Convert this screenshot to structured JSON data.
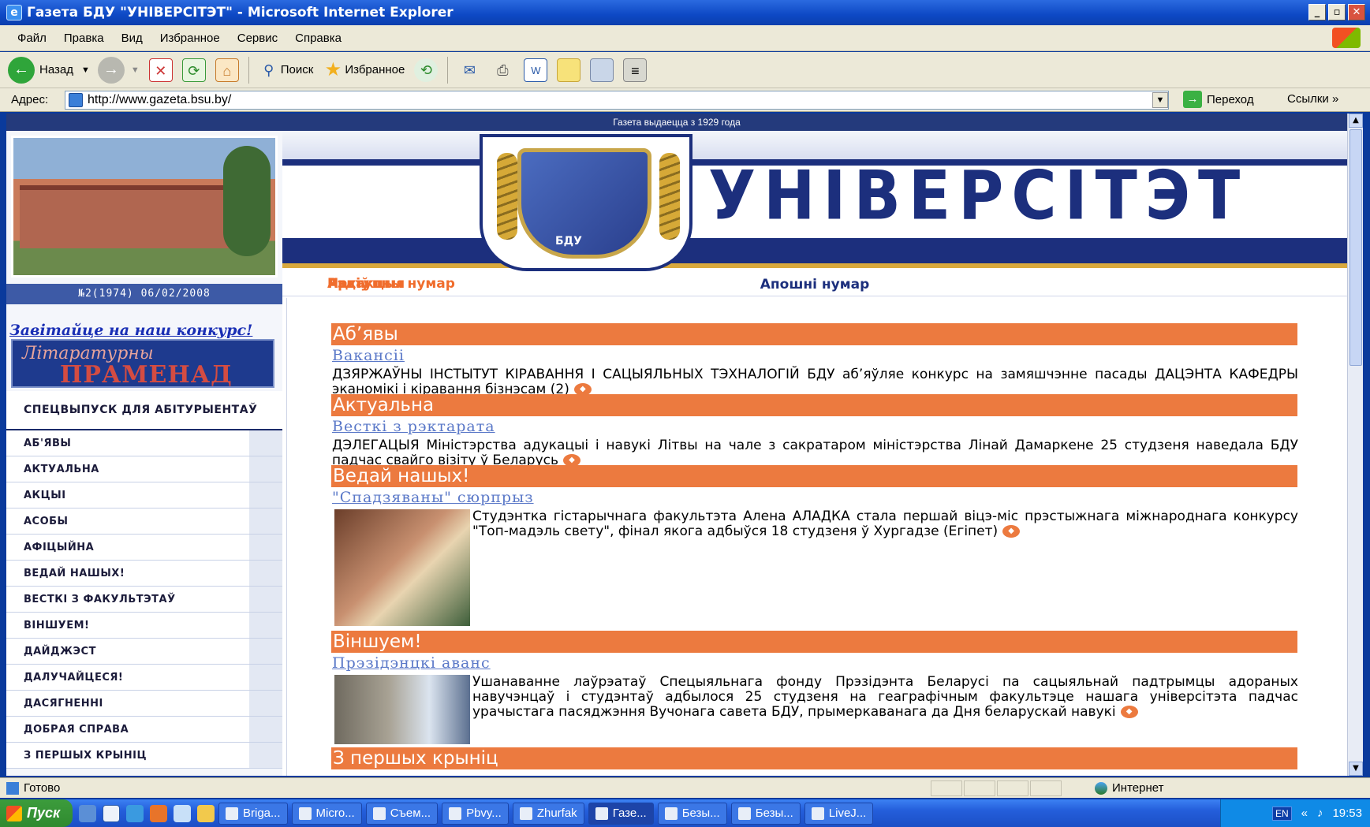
{
  "window": {
    "title": "Газета БДУ \"УНІВЕРСІТЭТ\" - Microsoft Internet Explorer"
  },
  "menu": [
    "Файл",
    "Правка",
    "Вид",
    "Избранное",
    "Сервис",
    "Справка"
  ],
  "toolbar": {
    "back": "Назад",
    "search": "Поиск",
    "favorites": "Избранное"
  },
  "address": {
    "label": "Адрес:",
    "url": "http://www.gazeta.bsu.by/",
    "go": "Переход",
    "links": "Ссылки"
  },
  "site": {
    "since": "Газета выдаецца з 1929 года",
    "brand": "УНІВЕРСІТЭТ",
    "crest_text": "БДУ",
    "issue": "№2(1974) 06/02/2008",
    "konkurs": "Завітайце на наш конкурс!",
    "banner_line1": "Літаратурны",
    "banner_line2": "ПРАМЕНАД",
    "tabs": [
      "Апошні нумар",
      "Наступны нумар",
      "Архіў",
      "Рэдакцыя"
    ],
    "nav": [
      "СПЕЦВЫПУСК ДЛЯ АБІТУРЫЕНТАЎ",
      "АБ'ЯВЫ",
      "АКТУАЛЬНА",
      "АКЦЫІ",
      "АСОБЫ",
      "АФІЦЫЙНА",
      "ВЕДАЙ НАШЫХ!",
      "ВЕСТКІ З ФАКУЛЬТЭТАЎ",
      "ВІНШУЕМ!",
      "ДАЙДЖЭСТ",
      "ДАЛУЧАЙЦЕСЯ!",
      "ДАСЯГНЕННІ",
      "ДОБРАЯ СПРАВА",
      "З ПЕРШЫХ КРЫНІЦ"
    ]
  },
  "sections": [
    {
      "title": "Аб’явы",
      "headline": "Вакансіі",
      "text": "ДЗЯРЖАЎНЫ ІНСТЫТУТ КІРАВАННЯ І САЦЫЯЛЬНЫХ ТЭХНАЛОГІЙ БДУ аб’яўляе конкурс на замяшчэнне пасады ДАЦЭНТА КАФЕДРЫ эканомікі і кіравання бізнэсам (2)"
    },
    {
      "title": "Актуальна",
      "headline": "Весткі з рэктарата",
      "text": "ДЭЛЕГАЦЫЯ Міністэрства адукацыі і навукі Літвы на чале з сакратаром міністэрства Лінай Дамаркене 25 студзеня наведала БДУ падчас свайго візіту ў Беларусь"
    },
    {
      "title": "Ведай нашых!",
      "headline": "\"Спадзяваны\" сюрпрыз",
      "text": "Студэнтка гістарычнага факультэта Алена АЛАДКА стала першай віцэ-міс прэстыжнага міжнароднага конкурсу \"Топ-мадэль свету\", фінал якога адбыўся 18 студзеня ў Хургадзе (Егіпет)"
    },
    {
      "title": "Віншуем!",
      "headline": "Прэзідэнцкі аванс",
      "text": "Ушанаванне лаўрэатаў Спецыяльнага фонду Прэзідэнта Беларусі па сацыяльнай падтрымцы адораных навучэнцаў і студэнтаў адбылося 25 студзеня на геаграфічным факультэце нашага універсітэта падчас урачыстага пасяджэння Вучонага савета БДУ, прымеркаванага да Дня беларускай навукі"
    },
    {
      "title": "З першых крыніц"
    }
  ],
  "status": {
    "left": "Готово",
    "zone": "Интернет"
  },
  "taskbar": {
    "start": "Пуск",
    "tasks": [
      "Briga...",
      "Micro...",
      "Съем...",
      "Pbvy...",
      "Zhurfak",
      "Газе...",
      "Безы...",
      "Безы...",
      "LiveJ..."
    ],
    "lang": "EN",
    "time": "19:53"
  }
}
